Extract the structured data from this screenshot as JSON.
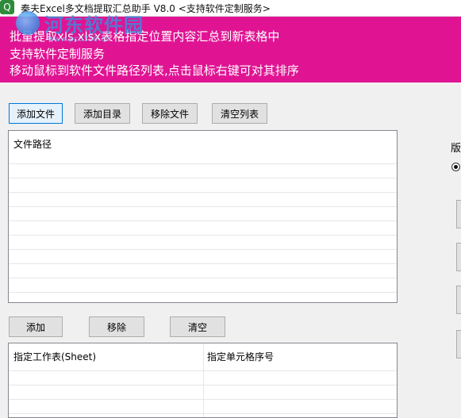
{
  "window": {
    "title": "秦夫Excel多文档提取汇总助手 V8.0  <支持软件定制服务>",
    "icon": "q-app-icon"
  },
  "watermark": {
    "text": "河东软件园",
    "url": "www.pc0359.cn"
  },
  "banner": {
    "line1": "批量提取xls,xlsx表格指定位置内容汇总到新表格中",
    "line2": "支持软件定制服务",
    "line3": "移动鼠标到软件文件路径列表,点击鼠标右键可对其排序",
    "color": "#e01493"
  },
  "file_toolbar": {
    "add_file": "添加文件",
    "add_dir": "添加目录",
    "remove_file": "移除文件",
    "clear_list": "清空列表"
  },
  "file_list": {
    "header": "文件路径"
  },
  "sheet_toolbar": {
    "add": "添加",
    "remove": "移除",
    "clear": "清空"
  },
  "sheet_table": {
    "col_sheet": "指定工作表(Sheet)",
    "col_cell": "指定单元格序号"
  },
  "right_panel": {
    "label": "版"
  }
}
